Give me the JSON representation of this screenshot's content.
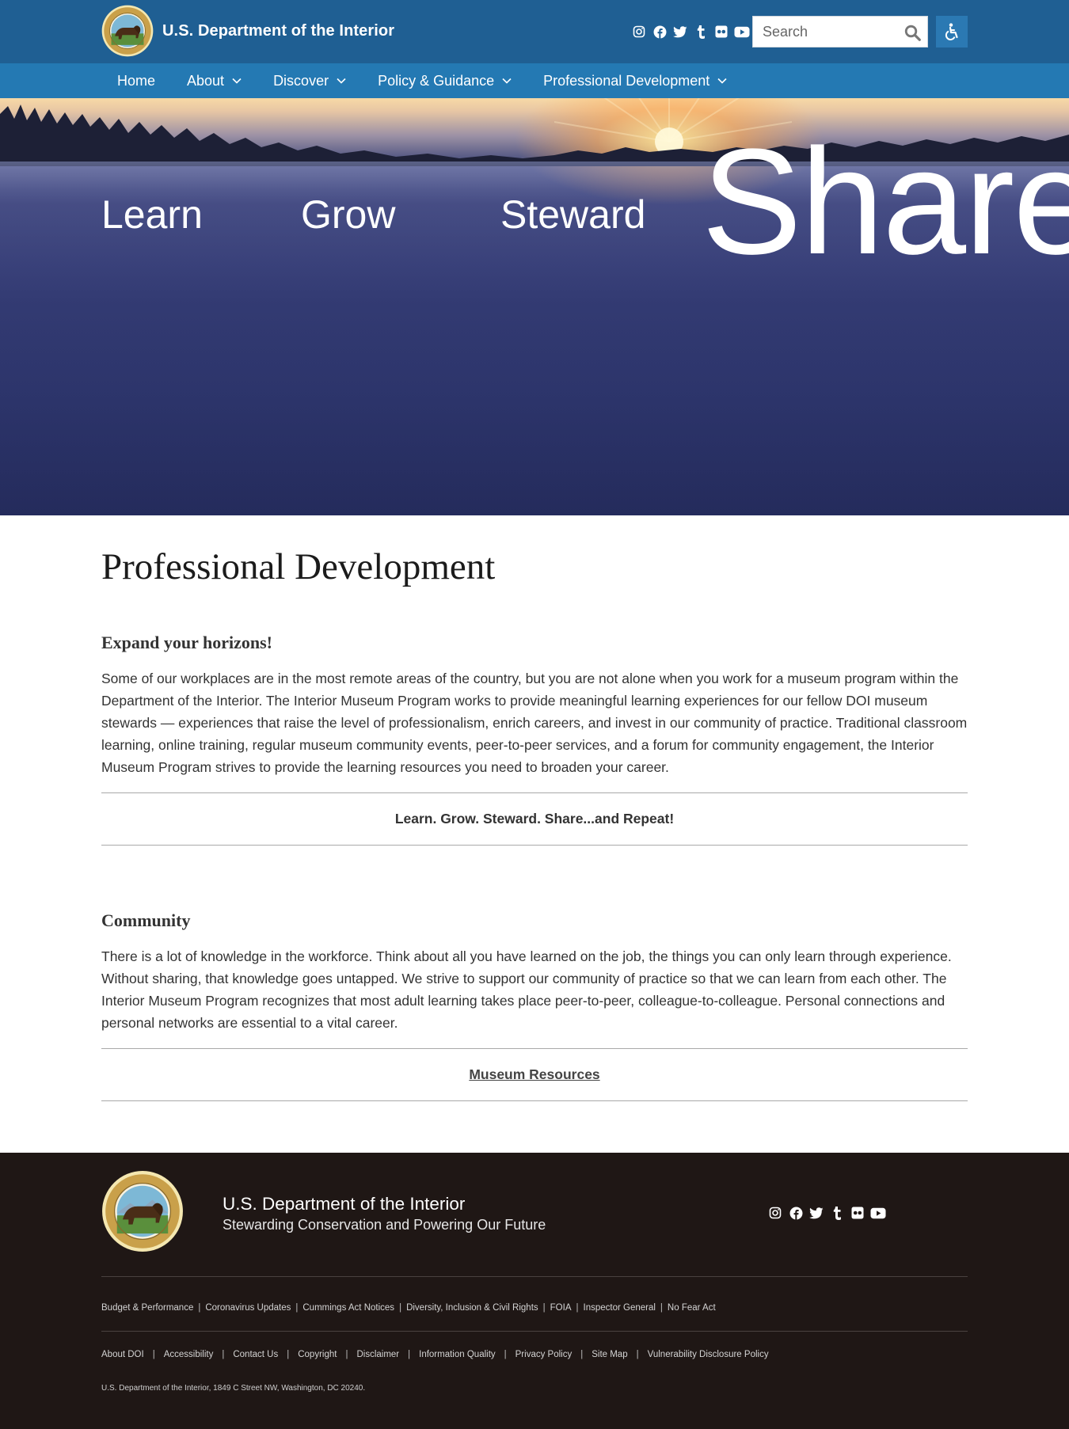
{
  "header": {
    "site_title": "U.S. Department of the Interior",
    "seal_text": "DEPARTMENT OF THE INTERIOR · MARCH 3, 1849",
    "social_icons": [
      "instagram-icon",
      "facebook-icon",
      "twitter-icon",
      "tumblr-icon",
      "flickr-icon",
      "youtube-icon"
    ],
    "search": {
      "placeholder": "Search",
      "value": ""
    },
    "accessibility_icon": "wheelchair-icon"
  },
  "nav": {
    "items": [
      {
        "label": "Home",
        "has_dropdown": false
      },
      {
        "label": "About",
        "has_dropdown": true
      },
      {
        "label": "Discover",
        "has_dropdown": true
      },
      {
        "label": "Policy & Guidance",
        "has_dropdown": true
      },
      {
        "label": "Professional Development",
        "has_dropdown": true
      }
    ]
  },
  "hero": {
    "words": [
      "Learn",
      "Grow",
      "Steward",
      "Share"
    ]
  },
  "main": {
    "title": "Professional Development",
    "sections": [
      {
        "heading": "Expand your horizons!",
        "body": "Some of our workplaces are in the most remote areas of the country, but you are not alone when you work for a museum program within the Department of the Interior. The Interior Museum Program works to provide meaningful learning experiences for our fellow DOI museum stewards — experiences that raise the level of professionalism, enrich careers, and invest in our community of practice. Traditional classroom learning, online training, regular museum community events, peer-to-peer services, and a forum for community engagement, the Interior Museum Program strives to provide the learning resources you need to broaden your career.",
        "callout": "Learn. Grow. Steward. Share...and Repeat!"
      },
      {
        "heading": "Community",
        "body": "There is a lot of knowledge in the workforce. Think about all you have learned on the job, the things you can only learn through experience. Without sharing, that knowledge goes untapped. We strive to support our community of practice so that we can learn from each other. The Interior Museum Program recognizes that most adult learning takes place peer-to-peer, colleague-to-colleague. Personal connections and personal networks are essential to a vital career.",
        "link": "Museum Resources"
      }
    ]
  },
  "footer": {
    "title": "U.S. Department of the Interior",
    "tagline": "Stewarding Conservation and Powering Our Future",
    "social_icons": [
      "instagram-icon",
      "facebook-icon",
      "twitter-icon",
      "tumblr-icon",
      "flickr-icon",
      "youtube-icon"
    ],
    "links_row1": [
      "Budget & Performance",
      "Coronavirus Updates",
      "Cummings Act Notices",
      "Diversity, Inclusion & Civil Rights",
      "FOIA",
      "Inspector General",
      "No Fear Act"
    ],
    "links_row2": [
      "About DOI",
      "Accessibility",
      "Contact Us",
      "Copyright",
      "Disclaimer",
      "Information Quality",
      "Privacy Policy",
      "Site Map",
      "Vulnerability Disclosure Policy"
    ],
    "address": "U.S. Department of the Interior, 1849 C Street NW, Washington, DC 20240."
  },
  "colors": {
    "header_bg": "#1f5f93",
    "nav_bg": "#2479b3",
    "footer_bg": "#1f1715",
    "accent_button": "#2b79b3"
  }
}
